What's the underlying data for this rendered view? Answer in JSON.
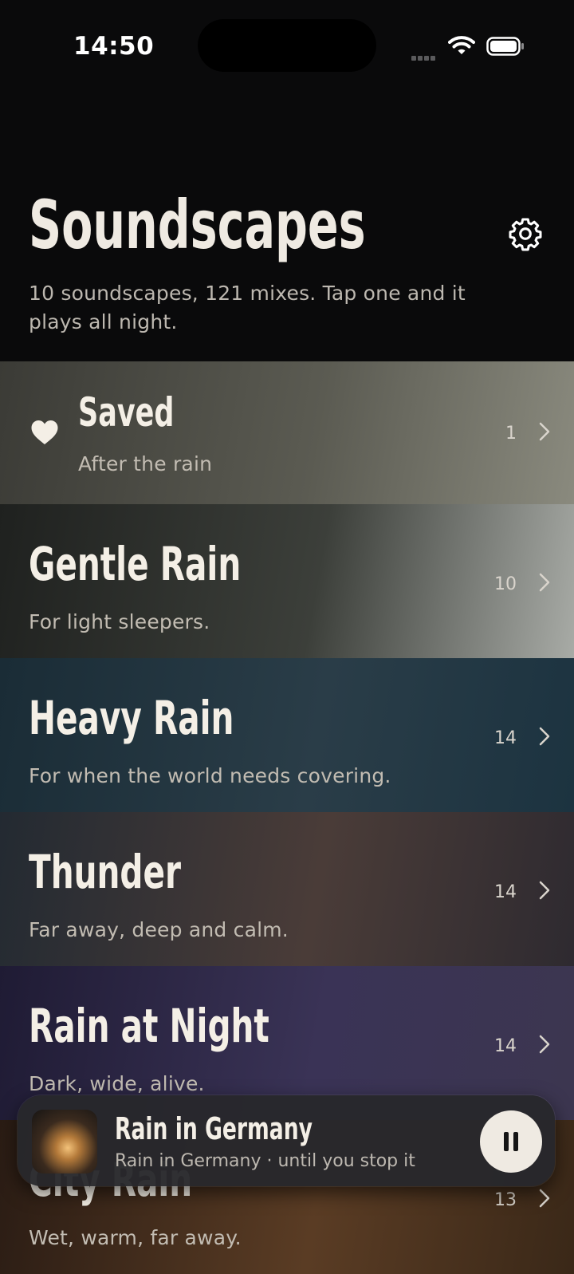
{
  "status_bar": {
    "time": "14:50"
  },
  "header": {
    "title": "Soundscapes",
    "subtitle": "10 soundscapes, 121 mixes. Tap one and it plays all night."
  },
  "icons": [
    "signal-icon",
    "wifi-icon",
    "battery-icon",
    "gear-icon",
    "heart-icon",
    "chevron-right-icon",
    "pause-icon"
  ],
  "list": {
    "saved": {
      "title": "Saved",
      "desc": "After the rain",
      "count": "1",
      "colors": [
        "#3b3b36",
        "#5b5b52",
        "#8a8a7e"
      ]
    },
    "items": [
      {
        "title": "Gentle Rain",
        "desc": "For light sleepers.",
        "count": "10",
        "colors": [
          "#1f211f",
          "#3c3f3a",
          "#a8aba6"
        ]
      },
      {
        "title": "Heavy Rain",
        "desc": "For when the world needs covering.",
        "count": "14",
        "colors": [
          "#1a2c36",
          "#2a3d48",
          "#1c3340"
        ]
      },
      {
        "title": "Thunder",
        "desc": "Far away, deep and calm.",
        "count": "14",
        "colors": [
          "#232a32",
          "#4a3c38",
          "#2e2a30"
        ]
      },
      {
        "title": "Rain at Night",
        "desc": "Dark, wide, alive.",
        "count": "14",
        "colors": [
          "#1f1b34",
          "#3a3356",
          "#3c3650"
        ]
      },
      {
        "title": "City Rain",
        "desc": "Wet, warm, far away.",
        "count": "13",
        "colors": [
          "#2a1c14",
          "#5a3c24",
          "#3a2818"
        ]
      }
    ]
  },
  "player": {
    "title": "Rain in Germany",
    "subtitle": "Rain in Germany · until you stop it"
  }
}
